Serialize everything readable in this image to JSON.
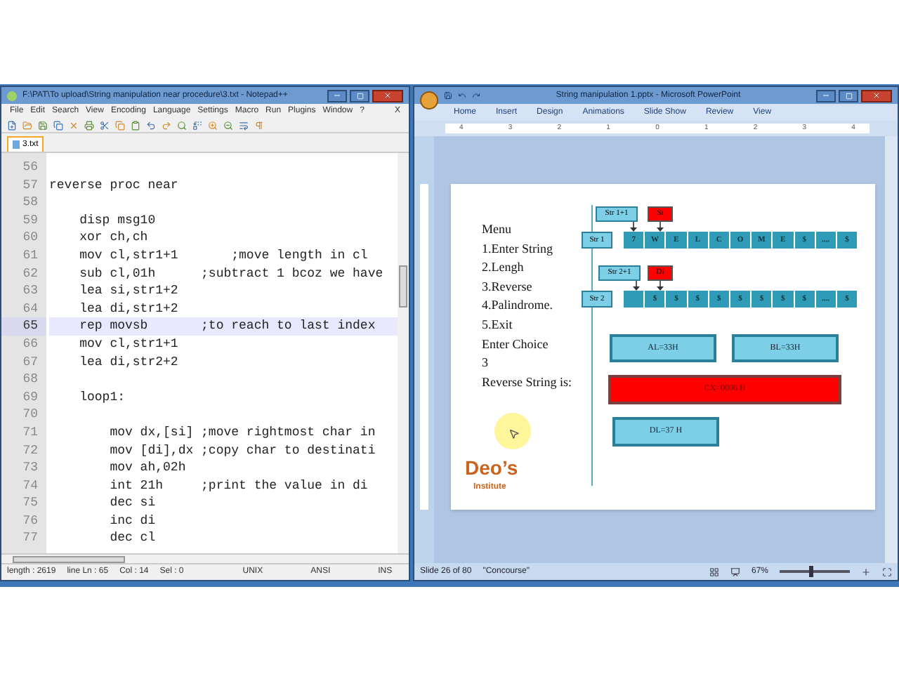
{
  "notepad": {
    "title": "F:\\PAT\\To upload\\String manipulation near procedure\\3.txt - Notepad++",
    "menu": [
      "File",
      "Edit",
      "Search",
      "View",
      "Encoding",
      "Language",
      "Settings",
      "Macro",
      "Run",
      "Plugins",
      "Window",
      "?"
    ],
    "close_doc": "X",
    "tab": {
      "label": "3.txt",
      "selected": true
    },
    "lines": [
      {
        "number": "56",
        "current": false
      },
      {
        "number": "57",
        "text": "reverse proc near",
        "current": false
      },
      {
        "number": "58",
        "current": false
      },
      {
        "number": "59",
        "text": "    disp msg10",
        "current": false
      },
      {
        "number": "60",
        "text": "    xor ch,ch",
        "current": false
      },
      {
        "number": "61",
        "text": "    mov cl,str1+1       ;move length in cl",
        "current": false
      },
      {
        "number": "62",
        "text": "    sub cl,01h      ;subtract 1 bcoz we have",
        "current": false
      },
      {
        "number": "63",
        "text": "    lea si,str1+2",
        "current": false
      },
      {
        "number": "64",
        "text": "    lea di,str1+2",
        "current": false
      },
      {
        "number": "65",
        "text": "    rep movsb       ;to reach to last index",
        "current": true
      },
      {
        "number": "66",
        "text": "    mov cl,str1+1",
        "current": false
      },
      {
        "number": "67",
        "text": "    lea di,str2+2",
        "current": false
      },
      {
        "number": "68",
        "current": false
      },
      {
        "number": "69",
        "text": "    loop1:",
        "current": false
      },
      {
        "number": "70",
        "current": false
      },
      {
        "number": "71",
        "text": "        mov dx,[si] ;move rightmost char in",
        "current": false
      },
      {
        "number": "72",
        "text": "        mov [di],dx ;copy char to destinati",
        "current": false
      },
      {
        "number": "73",
        "text": "        mov ah,02h",
        "current": false
      },
      {
        "number": "74",
        "text": "        int 21h     ;print the value in di",
        "current": false
      },
      {
        "number": "75",
        "text": "        dec si",
        "current": false
      },
      {
        "number": "76",
        "text": "        inc di",
        "current": false
      },
      {
        "number": "77",
        "text": "        dec cl",
        "current": false
      }
    ],
    "status": [
      "length : 2619",
      "line Ln : 65",
      "Col : 14",
      "Sel : 0",
      "UNIX",
      "ANSI",
      "INS"
    ]
  },
  "powerpoint": {
    "title": "String manipulation 1.pptx - Microsoft PowerPoint",
    "tabs": [
      "Home",
      "Insert",
      "Design",
      "Animations",
      "Slide Show",
      "Review",
      "View"
    ],
    "ruler": [
      "4",
      "3",
      "2",
      "1",
      "0",
      "1",
      "2",
      "3",
      "4"
    ],
    "slide": {
      "menu_lines": [
        "Menu",
        "1.Enter String",
        "2.Lengh",
        "3.Reverse",
        "4.Palindrome.",
        "5.Exit",
        "Enter Choice",
        "3",
        "Reverse String is:"
      ],
      "rows": [
        {
          "pointer": "Str 1+1",
          "index": "Si",
          "label": "Str 1",
          "cells": [
            "7",
            "W",
            "E",
            "L",
            "C",
            "O",
            "M",
            "E",
            "$",
            "....",
            "$"
          ]
        },
        {
          "pointer": "Str 2+1",
          "index": "Di",
          "label": "Str 2",
          "cells": [
            "",
            "$",
            "$",
            "$",
            "$",
            "$",
            "$",
            "$",
            "$",
            "....",
            "$"
          ]
        }
      ],
      "registers": [
        {
          "label": "AL=33H",
          "highlighted": false
        },
        {
          "label": "BL=33H",
          "highlighted": false
        },
        {
          "label": "CX=0006 H",
          "highlighted": true
        },
        {
          "label": "DL=37 H",
          "highlighted": false
        }
      ],
      "logo": {
        "name": "Deo’s",
        "tagline": "Institute"
      }
    },
    "status": [
      "Slide 26 of 80",
      "\"Concourse\""
    ],
    "zoom": "67%",
    "zoom_slider": {
      "level": 0.45
    }
  }
}
